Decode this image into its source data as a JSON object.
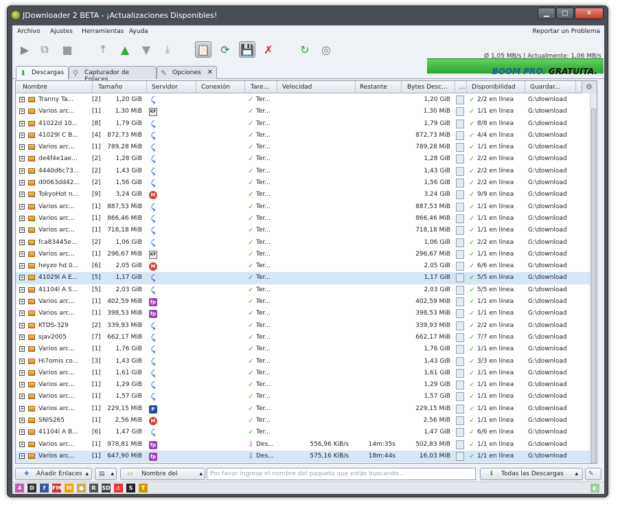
{
  "window": {
    "title": "JDownloader 2 BETA - ¡Actualizaciones Disponibles!",
    "min": "▁",
    "max": "▢",
    "close": "✕"
  },
  "menu": {
    "items": [
      "Archivo",
      "Ajustes",
      "Herramientas",
      "Ayuda"
    ],
    "report": "Reportar un Problema"
  },
  "speed": {
    "text": "Ø 1,05 MB/s | Actualmente: 1,06 MB/s"
  },
  "tabs": [
    {
      "label": "Descargas",
      "icon": "download-arrow-icon"
    },
    {
      "label": "Capturador de Enlaces",
      "icon": "magnifier-icon"
    },
    {
      "label": "Opciones",
      "icon": "wrench-icon"
    }
  ],
  "brand": {
    "boom": "BOOM",
    "pro": "PRO.",
    "free": "GRATUITA."
  },
  "columns": [
    "Nombre",
    "Tamaño",
    "Servidor",
    "Conexión",
    "Tare...",
    "Velocidad",
    "Restante",
    "Bytes Desc...",
    "...",
    "Disponibilidad",
    "Guardar..."
  ],
  "rows": [
    {
      "name": "Tranny Ta...",
      "count": "[2]",
      "size": "1,20 GiB",
      "host": "u",
      "task": "Ter...",
      "speed": "",
      "remaining": "",
      "bytes": "1,20 GiB",
      "avail": "2/2 en línea",
      "save": "G:\\download",
      "done": true
    },
    {
      "name": "Varios arc...",
      "count": "[1]",
      "size": "1,30 MiB",
      "host": "k",
      "task": "Ter...",
      "speed": "",
      "remaining": "",
      "bytes": "1,30 MiB",
      "avail": "1/1 en línea",
      "save": "G:\\download",
      "done": true
    },
    {
      "name": "41022d 10...",
      "count": "[8]",
      "size": "1,79 GiB",
      "host": "u",
      "task": "Ter...",
      "speed": "",
      "remaining": "",
      "bytes": "1,79 GiB",
      "avail": "8/8 en línea",
      "save": "G:\\download",
      "done": true
    },
    {
      "name": "41029l C B...",
      "count": "[4]",
      "size": "872,73 MiB",
      "host": "u",
      "task": "Ter...",
      "speed": "",
      "remaining": "",
      "bytes": "872,73 MiB",
      "avail": "4/4 en línea",
      "save": "G:\\download",
      "done": true
    },
    {
      "name": "Varios arc...",
      "count": "[1]",
      "size": "789,28 MiB",
      "host": "u",
      "task": "Ter...",
      "speed": "",
      "remaining": "",
      "bytes": "789,28 MiB",
      "avail": "1/1 en línea",
      "save": "G:\\download",
      "done": true
    },
    {
      "name": "de4f4e1ae...",
      "count": "[2]",
      "size": "1,28 GiB",
      "host": "u",
      "task": "Ter...",
      "speed": "",
      "remaining": "",
      "bytes": "1,28 GiB",
      "avail": "2/2 en línea",
      "save": "G:\\download",
      "done": true
    },
    {
      "name": "4440d6c73...",
      "count": "[2]",
      "size": "1,43 GiB",
      "host": "u",
      "task": "Ter...",
      "speed": "",
      "remaining": "",
      "bytes": "1,43 GiB",
      "avail": "2/2 en línea",
      "save": "G:\\download",
      "done": true
    },
    {
      "name": "d0063dd42...",
      "count": "[2]",
      "size": "1,56 GiB",
      "host": "u",
      "task": "Ter...",
      "speed": "",
      "remaining": "",
      "bytes": "1,56 GiB",
      "avail": "2/2 en línea",
      "save": "G:\\download",
      "done": true
    },
    {
      "name": "TokyoHot n...",
      "count": "[9]",
      "size": "3,24 GiB",
      "host": "m",
      "task": "Ter...",
      "speed": "",
      "remaining": "",
      "bytes": "3,24 GiB",
      "avail": "9/9 en línea",
      "save": "G:\\download",
      "done": true
    },
    {
      "name": "Varios arc...",
      "count": "[1]",
      "size": "887,53 MiB",
      "host": "u",
      "task": "Ter...",
      "speed": "",
      "remaining": "",
      "bytes": "887,53 MiB",
      "avail": "1/1 en línea",
      "save": "G:\\download",
      "done": true
    },
    {
      "name": "Varios arc...",
      "count": "[1]",
      "size": "866,46 MiB",
      "host": "u",
      "task": "Ter...",
      "speed": "",
      "remaining": "",
      "bytes": "866,46 MiB",
      "avail": "1/1 en línea",
      "save": "G:\\download",
      "done": true
    },
    {
      "name": "Varios arc...",
      "count": "[1]",
      "size": "718,18 MiB",
      "host": "u",
      "task": "Ter...",
      "speed": "",
      "remaining": "",
      "bytes": "718,18 MiB",
      "avail": "1/1 en línea",
      "save": "G:\\download",
      "done": true
    },
    {
      "name": "fca83445e...",
      "count": "[2]",
      "size": "1,06 GiB",
      "host": "u",
      "task": "Ter...",
      "speed": "",
      "remaining": "",
      "bytes": "1,06 GiB",
      "avail": "2/2 en línea",
      "save": "G:\\download",
      "done": true
    },
    {
      "name": "Varios arc...",
      "count": "[1]",
      "size": "296,67 MiB",
      "host": "k",
      "task": "Ter...",
      "speed": "",
      "remaining": "",
      "bytes": "296,67 MiB",
      "avail": "1/1 en línea",
      "save": "G:\\download",
      "done": true
    },
    {
      "name": "heyzo hd 0...",
      "count": "[6]",
      "size": "2,05 GiB",
      "host": "m",
      "task": "Ter...",
      "speed": "",
      "remaining": "",
      "bytes": "2,05 GiB",
      "avail": "6/6 en línea",
      "save": "G:\\download",
      "done": true
    },
    {
      "name": "41029l A E...",
      "count": "[5]",
      "size": "1,17 GiB",
      "host": "u",
      "task": "Ter...",
      "speed": "",
      "remaining": "",
      "bytes": "1,17 GiB",
      "avail": "5/5 en línea",
      "save": "G:\\download",
      "done": true,
      "selected": true
    },
    {
      "name": "41104l A S...",
      "count": "[5]",
      "size": "2,03 GiB",
      "host": "u",
      "task": "Ter...",
      "speed": "",
      "remaining": "",
      "bytes": "2,03 GiB",
      "avail": "5/5 en línea",
      "save": "G:\\download",
      "done": true
    },
    {
      "name": "Varios arc...",
      "count": "[1]",
      "size": "402,59 MiB",
      "host": "f",
      "task": "Ter...",
      "speed": "",
      "remaining": "",
      "bytes": "402,59 MiB",
      "avail": "1/1 en línea",
      "save": "G:\\download",
      "done": true
    },
    {
      "name": "Varios arc...",
      "count": "[1]",
      "size": "398,53 MiB",
      "host": "f",
      "task": "Ter...",
      "speed": "",
      "remaining": "",
      "bytes": "398,53 MiB",
      "avail": "1/1 en línea",
      "save": "G:\\download",
      "done": true
    },
    {
      "name": "KTDS-329",
      "count": "[2]",
      "size": "339,93 MiB",
      "host": "u",
      "task": "Ter...",
      "speed": "",
      "remaining": "",
      "bytes": "339,93 MiB",
      "avail": "2/2 en línea",
      "save": "G:\\download",
      "done": true
    },
    {
      "name": "sjav2005",
      "count": "[7]",
      "size": "662,17 MiB",
      "host": "u",
      "task": "Ter...",
      "speed": "",
      "remaining": "",
      "bytes": "662,17 MiB",
      "avail": "7/7 en línea",
      "save": "G:\\download",
      "done": true
    },
    {
      "name": "Varios arc...",
      "count": "[1]",
      "size": "1,76 GiB",
      "host": "u",
      "task": "Ter...",
      "speed": "",
      "remaining": "",
      "bytes": "1,76 GiB",
      "avail": "1/1 en línea",
      "save": "G:\\download",
      "done": true
    },
    {
      "name": "Hi7omis co...",
      "count": "[3]",
      "size": "1,43 GiB",
      "host": "u",
      "task": "Ter...",
      "speed": "",
      "remaining": "",
      "bytes": "1,43 GiB",
      "avail": "3/3 en línea",
      "save": "G:\\download",
      "done": true
    },
    {
      "name": "Varios arc...",
      "count": "[1]",
      "size": "1,61 GiB",
      "host": "u",
      "task": "Ter...",
      "speed": "",
      "remaining": "",
      "bytes": "1,61 GiB",
      "avail": "1/1 en línea",
      "save": "G:\\download",
      "done": true
    },
    {
      "name": "Varios arc...",
      "count": "[1]",
      "size": "1,29 GiB",
      "host": "u",
      "task": "Ter...",
      "speed": "",
      "remaining": "",
      "bytes": "1,29 GiB",
      "avail": "1/1 en línea",
      "save": "G:\\download",
      "done": true
    },
    {
      "name": "Varios arc...",
      "count": "[1]",
      "size": "1,57 GiB",
      "host": "u",
      "task": "Ter...",
      "speed": "",
      "remaining": "",
      "bytes": "1,57 GiB",
      "avail": "1/1 en línea",
      "save": "G:\\download",
      "done": true
    },
    {
      "name": "Varios arc...",
      "count": "[1]",
      "size": "229,15 MiB",
      "host": "p",
      "task": "Ter...",
      "speed": "",
      "remaining": "",
      "bytes": "229,15 MiB",
      "avail": "1/1 en línea",
      "save": "G:\\download",
      "done": true
    },
    {
      "name": "SNIS265",
      "count": "[1]",
      "size": "2,56 MiB",
      "host": "m",
      "task": "Ter...",
      "speed": "",
      "remaining": "",
      "bytes": "2,56 MiB",
      "avail": "1/1 en línea",
      "save": "G:\\download",
      "done": true
    },
    {
      "name": "41104l A B...",
      "count": "[6]",
      "size": "1,47 GiB",
      "host": "u",
      "task": "Ter...",
      "speed": "",
      "remaining": "",
      "bytes": "1,47 GiB",
      "avail": "6/6 en línea",
      "save": "G:\\download",
      "done": true
    },
    {
      "name": "Varios arc...",
      "count": "[1]",
      "size": "978,81 MiB",
      "host": "f",
      "task": "Des...",
      "speed": "556,96 KiB/s",
      "remaining": "14m:35s",
      "bytes": "502,83 MiB",
      "avail": "1/1 en línea",
      "save": "G:\\download",
      "done": false
    },
    {
      "name": "Varios arc...",
      "count": "[1]",
      "size": "647,90 MiB",
      "host": "f",
      "task": "Des...",
      "speed": "575,16 KiB/s",
      "remaining": "18m:44s",
      "bytes": "16,03 MiB",
      "avail": "1/1 en línea",
      "save": "G:\\download",
      "done": false,
      "selected": true
    }
  ],
  "bottom": {
    "add_links": "Añadir Enlaces",
    "package_name": "Nombre del paquete",
    "search_placeholder": "Por favor ingrese el nombre del paquete que estás buscando...",
    "all_downloads": "Todas las Descargas"
  },
  "host_labels": {
    "m": "M",
    "f": "fp",
    "k": "KF",
    "p": "P",
    "u": "⤹"
  },
  "colors": {
    "accent": "#1a5fa0",
    "speed_green": "#2aa12a",
    "selected_row": "#d5e6f7"
  }
}
